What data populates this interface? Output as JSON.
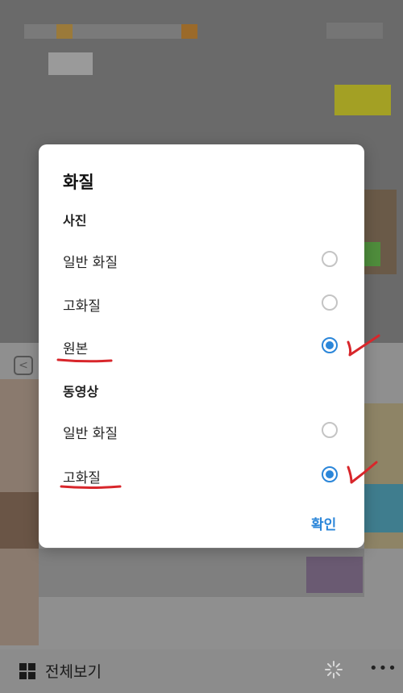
{
  "dialog": {
    "title": "화질",
    "sections": [
      {
        "label": "사진",
        "options": [
          {
            "label": "일반 화질",
            "selected": false
          },
          {
            "label": "고화질",
            "selected": false
          },
          {
            "label": "원본",
            "selected": true
          }
        ]
      },
      {
        "label": "동영상",
        "options": [
          {
            "label": "일반 화질",
            "selected": false
          },
          {
            "label": "고화질",
            "selected": true
          }
        ]
      }
    ],
    "confirm_label": "확인"
  },
  "bottom_bar": {
    "view_all_label": "전체보기",
    "more_label": "•••"
  },
  "colors": {
    "accent": "#2b86d9",
    "annotation": "#d8262b",
    "overlay": "#6e6e6e"
  }
}
